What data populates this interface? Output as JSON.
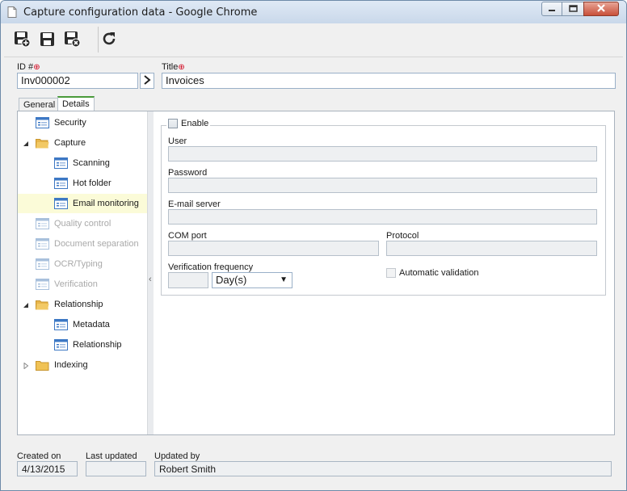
{
  "window": {
    "title": "Capture configuration data - Google Chrome",
    "icons": [
      "document-icon",
      "minimize-icon",
      "maximize-icon",
      "close-icon"
    ]
  },
  "toolbar": {
    "buttons": [
      {
        "name": "save-and-new-button",
        "icon": "save-new-icon"
      },
      {
        "name": "save-button",
        "icon": "save-icon"
      },
      {
        "name": "save-and-close-button",
        "icon": "save-close-icon"
      },
      {
        "name": "refresh-button",
        "icon": "refresh-icon"
      }
    ]
  },
  "header": {
    "id_label": "ID #",
    "id_value": "Inv000002",
    "title_label": "Title",
    "title_value": "Invoices",
    "required_marker": "⊕"
  },
  "tabs": [
    {
      "label": "General",
      "active": false
    },
    {
      "label": "Details",
      "active": true
    }
  ],
  "tree": {
    "items": [
      {
        "label": "Security",
        "level": 0,
        "icon": "form-icon",
        "state": "normal"
      },
      {
        "label": "Capture",
        "level": 0,
        "icon": "folder-open-icon",
        "state": "expanded"
      },
      {
        "label": "Scanning",
        "level": 1,
        "icon": "form-icon",
        "state": "normal"
      },
      {
        "label": "Hot folder",
        "level": 1,
        "icon": "form-icon",
        "state": "normal"
      },
      {
        "label": "Email monitoring",
        "level": 1,
        "icon": "form-icon",
        "state": "selected"
      },
      {
        "label": "Quality control",
        "level": 0,
        "icon": "form-icon",
        "state": "disabled"
      },
      {
        "label": "Document separation",
        "level": 0,
        "icon": "form-icon",
        "state": "disabled"
      },
      {
        "label": "OCR/Typing",
        "level": 0,
        "icon": "form-icon",
        "state": "disabled"
      },
      {
        "label": "Verification",
        "level": 0,
        "icon": "form-icon",
        "state": "disabled"
      },
      {
        "label": "Relationship",
        "level": 0,
        "icon": "folder-open-icon",
        "state": "expanded"
      },
      {
        "label": "Metadata",
        "level": 1,
        "icon": "form-icon",
        "state": "normal"
      },
      {
        "label": "Relationship",
        "level": 1,
        "icon": "form-icon",
        "state": "normal"
      },
      {
        "label": "Indexing",
        "level": 0,
        "icon": "folder-icon",
        "state": "collapsed"
      }
    ]
  },
  "details": {
    "enable_label": "Enable",
    "enable_checked": false,
    "user_label": "User",
    "user_value": "",
    "password_label": "Password",
    "password_value": "",
    "email_server_label": "E-mail server",
    "email_server_value": "",
    "com_port_label": "COM port",
    "com_port_value": "",
    "protocol_label": "Protocol",
    "protocol_value": "",
    "verification_frequency_label": "Verification frequency",
    "verification_frequency_value": "",
    "frequency_unit": "Day(s)",
    "automatic_validation_label": "Automatic validation",
    "automatic_validation_checked": false
  },
  "footer": {
    "created_on_label": "Created on",
    "created_on_value": "4/13/2015",
    "last_updated_label": "Last updated",
    "last_updated_value": "",
    "updated_by_label": "Updated by",
    "updated_by_value": "Robert Smith"
  },
  "colors": {
    "selected_row": "#fbfbd8",
    "active_tab_accent": "#4a9a3a",
    "required": "#d0021b",
    "folder": "#e8b64c",
    "form_icon": "#3d78c4"
  }
}
